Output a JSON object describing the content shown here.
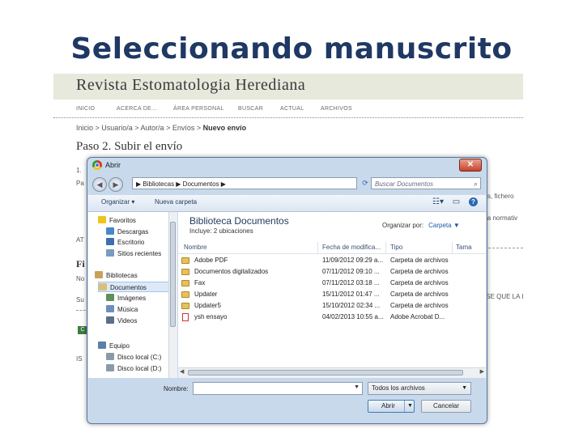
{
  "slide": {
    "title": "Seleccionando manuscrito"
  },
  "site": {
    "title": "Revista Estomatologia Herediana",
    "nav": [
      "INICIO",
      "ACERCA DE...",
      "ÁREA PERSONAL",
      "BUSCAR",
      "ACTUAL",
      "ARCHIVOS"
    ],
    "breadcrumb_prefix": "Inicio > Usuario/a > Autor/a > Envíos > ",
    "breadcrumb_current": "Nuevo envío",
    "step_title": "Paso 2. Subir el envío",
    "bg_fragments": {
      "line1": "1.",
      "line2": "Pa",
      "right1": "s, fichero",
      "right2": "la normativ",
      "line3": "AT",
      "heading": "Fi",
      "line4": "No",
      "line5": "Su",
      "right3": "ISE QUE LA I",
      "chip": "C",
      "line6": "IS",
      "right4": "("
    }
  },
  "dialog": {
    "title": "Abrir",
    "close_label": "✕",
    "address_path": "▶ Bibliotecas ▶ Documentos ▶",
    "search_placeholder": "Buscar Documentos",
    "toolbar": {
      "organize": "Organizar ▾",
      "new_folder": "Nueva carpeta"
    },
    "nav_pane": [
      {
        "label": "Favoritos",
        "color": "#f0c419"
      },
      {
        "label": "Descargas",
        "color": "#4a87c9"
      },
      {
        "label": "Escritorio",
        "color": "#3c6fb0"
      },
      {
        "label": "Sitios recientes",
        "color": "#7a9cc4"
      },
      {
        "label": "Bibliotecas",
        "color": "#c9a25a"
      },
      {
        "label": "Documentos",
        "color": "#d8c07a"
      },
      {
        "label": "Imágenes",
        "color": "#5f8f5a"
      },
      {
        "label": "Música",
        "color": "#6d8fc0"
      },
      {
        "label": "Videos",
        "color": "#5b6f8a"
      },
      {
        "label": "Equipo",
        "color": "#5a7fa8"
      },
      {
        "label": "Disco local (C:)",
        "color": "#8a9aaa"
      },
      {
        "label": "Disco local (D:)",
        "color": "#8a9aaa"
      }
    ],
    "library": {
      "title": "Biblioteca Documentos",
      "subtitle": "Incluye: 2 ubicaciones",
      "organize_by_label": "Organizar por:",
      "organize_by_value": "Carpeta ▼"
    },
    "columns": [
      "Nombre",
      "Fecha de modifica...",
      "Tipo",
      "Tama"
    ],
    "files": [
      {
        "name": "Adobe PDF",
        "date": "11/09/2012 09:29 a...",
        "type": "Carpeta de archivos",
        "icon": "folder"
      },
      {
        "name": "Documentos digitalizados",
        "date": "07/11/2012 09:10 ...",
        "type": "Carpeta de archivos",
        "icon": "folder"
      },
      {
        "name": "Fax",
        "date": "07/11/2012 03:18 ...",
        "type": "Carpeta de archivos",
        "icon": "folder"
      },
      {
        "name": "Updater",
        "date": "15/11/2012 01:47 ...",
        "type": "Carpeta de archivos",
        "icon": "folder"
      },
      {
        "name": "Updater5",
        "date": "15/10/2012 02:34 ...",
        "type": "Carpeta de archivos",
        "icon": "folder"
      },
      {
        "name": "ysh ensayo",
        "date": "04/02/2013 10:55 a...",
        "type": "Adobe Acrobat D...",
        "icon": "pdf"
      }
    ],
    "name_label": "Nombre:",
    "name_value": "",
    "file_type": "Todos los archivos",
    "open_label": "Abrir",
    "cancel_label": "Cancelar"
  }
}
